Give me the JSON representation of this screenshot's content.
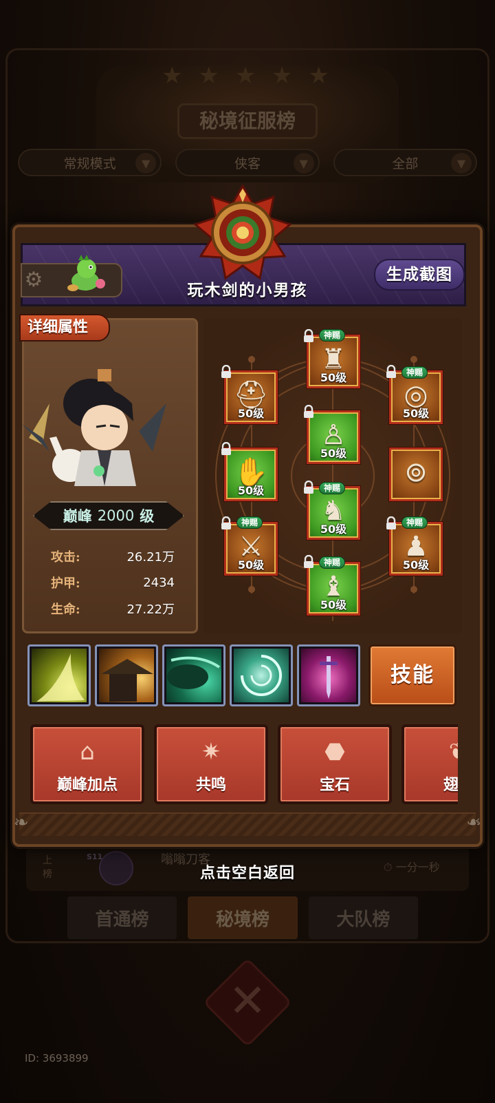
{
  "background": {
    "title": "秘境征服榜",
    "filters": [
      "常规模式",
      "侠客",
      "全部"
    ],
    "leaderboard_row": {
      "rank_text": "上榜",
      "level_tag": "S11",
      "name": "嗡嗡刀客",
      "time": "一分一秒"
    },
    "tabs": [
      "首通榜",
      "秘境榜",
      "大队榜"
    ],
    "active_tab_index": 1,
    "user_id": "ID: 3693899"
  },
  "modal": {
    "player_name": "玩木剑的小男孩",
    "screenshot_button": "生成截图",
    "details_tag": "详细属性",
    "level_plate": {
      "prefix": "巅峰",
      "value": "2000",
      "suffix": "级"
    },
    "stats": [
      {
        "label": "攻击:",
        "value": "26.21万"
      },
      {
        "label": "护甲:",
        "value": "2434"
      },
      {
        "label": "生命:",
        "value": "27.22万"
      }
    ],
    "equipment": [
      {
        "slot": "hat",
        "icon": "helmet-icon",
        "rarity": "brown",
        "level": "50级",
        "locked": true,
        "badge": ""
      },
      {
        "slot": "armor",
        "icon": "chair-icon",
        "rarity": "brown",
        "level": "50级",
        "locked": true,
        "badge": "神赐"
      },
      {
        "slot": "necklace",
        "icon": "necklace-icon",
        "rarity": "brown",
        "level": "50级",
        "locked": true,
        "badge": "神赐"
      },
      {
        "slot": "gloves",
        "icon": "glove-icon",
        "rarity": "green",
        "level": "50级",
        "locked": true,
        "badge": ""
      },
      {
        "slot": "robe",
        "icon": "robe-icon",
        "rarity": "green",
        "level": "50级",
        "locked": true,
        "badge": ""
      },
      {
        "slot": "ring",
        "icon": "ring-icon",
        "rarity": "brown",
        "level": "",
        "locked": false,
        "badge": ""
      },
      {
        "slot": "weapon",
        "icon": "sword-icon",
        "rarity": "brown",
        "level": "50级",
        "locked": true,
        "badge": "神赐"
      },
      {
        "slot": "pants",
        "icon": "pants-icon",
        "rarity": "green",
        "level": "50级",
        "locked": true,
        "badge": "神赐"
      },
      {
        "slot": "pet",
        "icon": "bell-icon",
        "rarity": "brown",
        "level": "50级",
        "locked": true,
        "badge": "神赐"
      },
      {
        "slot": "boots",
        "icon": "boots-icon",
        "rarity": "green",
        "level": "50级",
        "locked": true,
        "badge": "神赐"
      }
    ],
    "skills": [
      "slash-skill-icon",
      "straw-hat-skill-icon",
      "wind-skill-icon",
      "vortex-skill-icon",
      "sword-skill-icon"
    ],
    "skill_button": "技能",
    "functions": [
      {
        "icon": "house-plus-icon",
        "label": "巅峰加点"
      },
      {
        "icon": "resonance-icon",
        "label": "共鸣"
      },
      {
        "icon": "gem-icon",
        "label": "宝石"
      },
      {
        "icon": "wing-icon",
        "label": "翅膀"
      }
    ],
    "back_hint": "点击空白返回"
  },
  "colors": {
    "panel": "#3b2414",
    "banner": "#3e2d68",
    "accent_orange": "#c8503a",
    "green_badge": "#1f7a3a"
  }
}
